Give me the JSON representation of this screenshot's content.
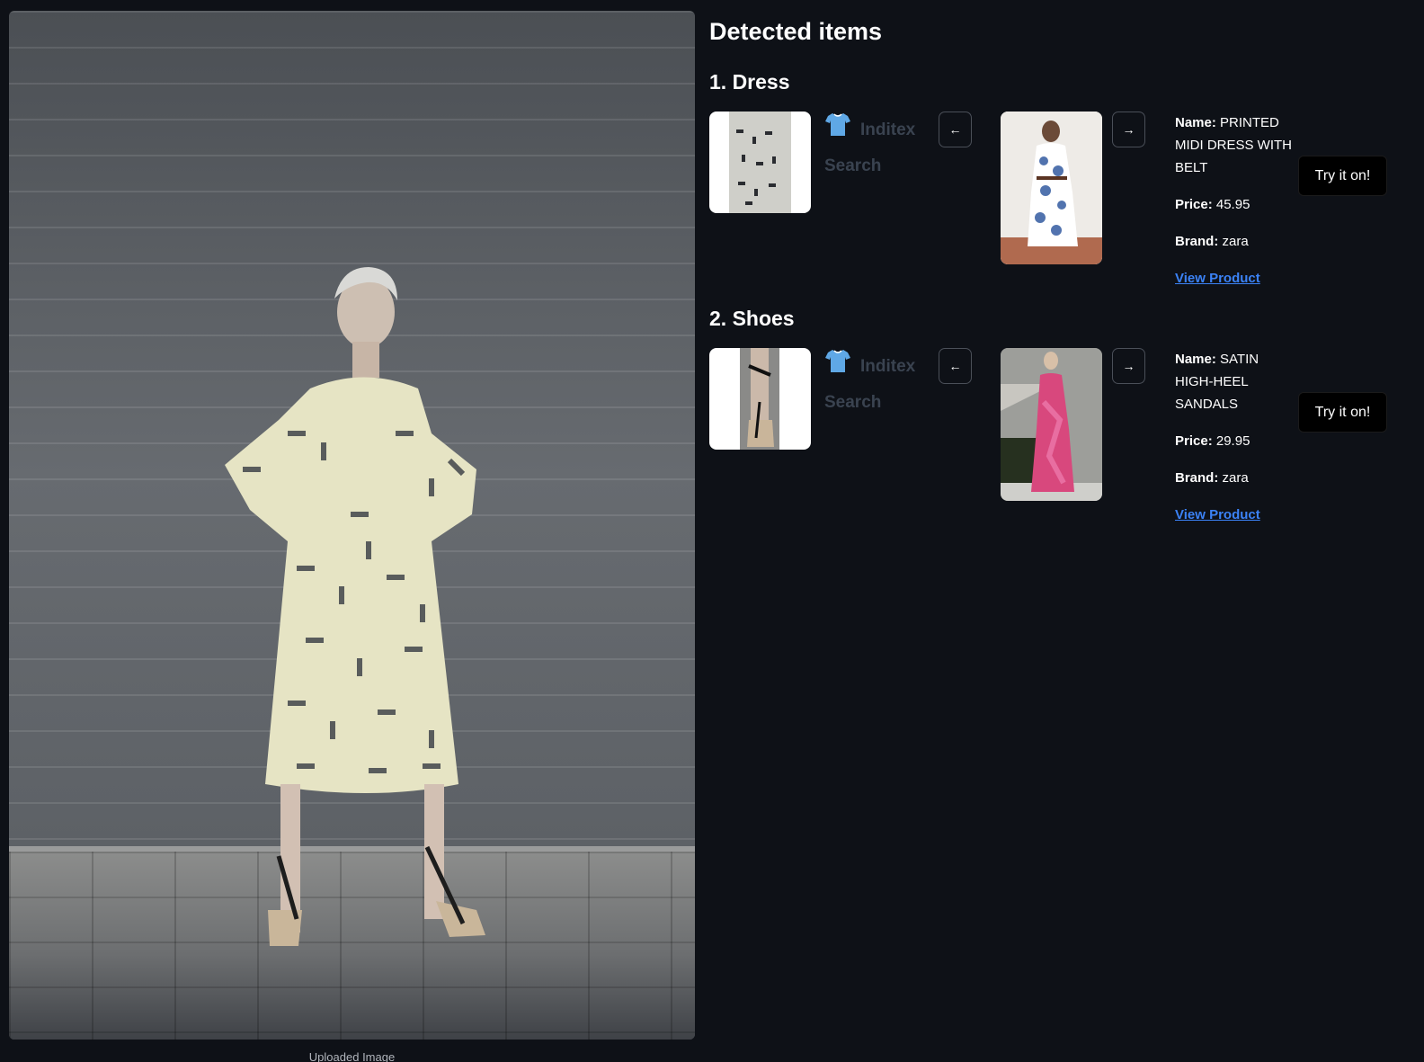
{
  "upload": {
    "caption": "Uploaded Image"
  },
  "results": {
    "title": "Detected items",
    "items": [
      {
        "heading": "1. Dress",
        "search_label": "Inditex Search",
        "search_icon": "shirt-icon",
        "prev_icon": "arrow-left-icon",
        "next_icon": "arrow-right-icon",
        "name_label": "Name:",
        "name": "PRINTED MIDI DRESS WITH BELT",
        "price_label": "Price:",
        "price": "45.95",
        "brand_label": "Brand:",
        "brand": "zara",
        "link_label": "View Product",
        "tryon_label": "Try it on!"
      },
      {
        "heading": "2. Shoes",
        "search_label": "Inditex Search",
        "search_icon": "shirt-icon",
        "prev_icon": "arrow-left-icon",
        "next_icon": "arrow-right-icon",
        "name_label": "Name:",
        "name": "SATIN HIGH-HEEL SANDALS",
        "price_label": "Price:",
        "price": "29.95",
        "brand_label": "Brand:",
        "brand": "zara",
        "link_label": "View Product",
        "tryon_label": "Try it on!"
      }
    ]
  },
  "colors": {
    "background": "#0e1117",
    "link": "#3b82f6",
    "muted_label": "#3a4350",
    "button_bg": "#000000"
  }
}
